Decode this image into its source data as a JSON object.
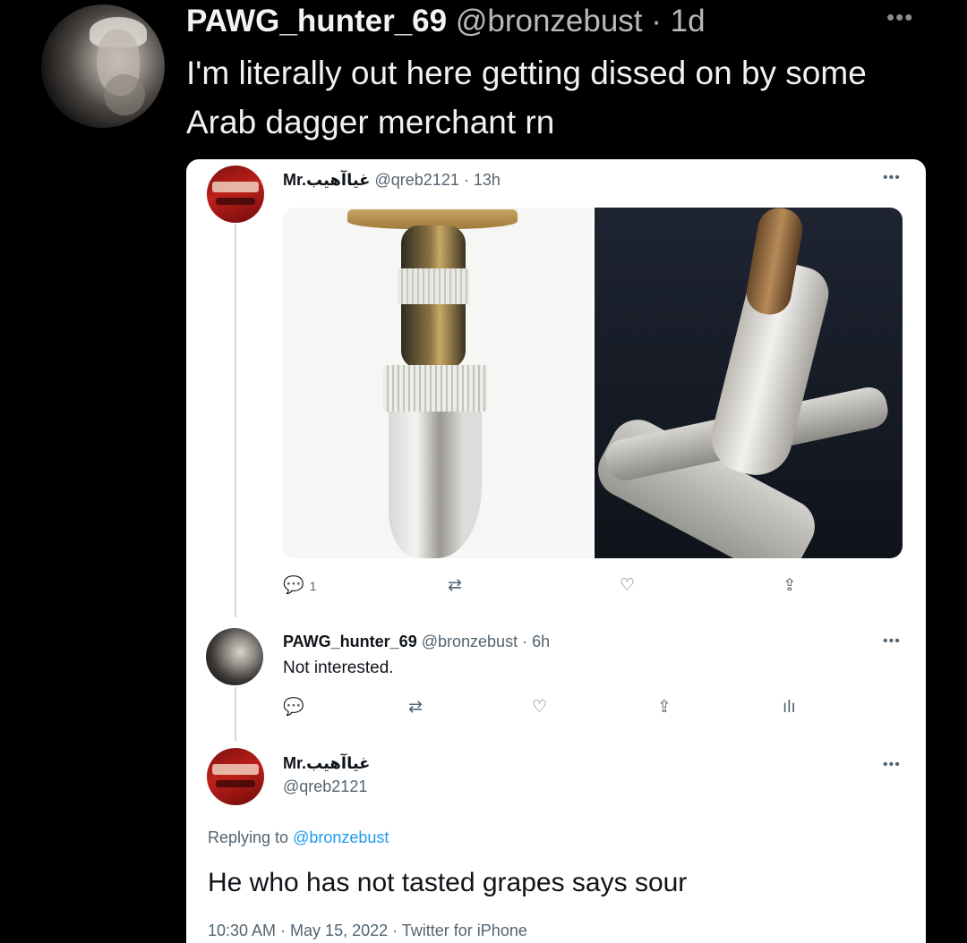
{
  "outer_tweet": {
    "display_name": "PAWG_hunter_69",
    "meta": "@bronzebust · 1d",
    "more_label": "•••",
    "text": "I'm literally out here getting dissed on by some Arab dagger merchant rn"
  },
  "quoted_tweet": {
    "display_name": "Mr.غياآهيب",
    "meta": "@qreb2121 · 13h",
    "more_label": "•••",
    "reply_count": "1"
  },
  "reply_tweet": {
    "display_name": "PAWG_hunter_69",
    "meta": "@bronzebust · 6h",
    "more_label": "•••",
    "text": "Not interested."
  },
  "final_tweet": {
    "display_name": "Mr.غياآهيب",
    "handle": "@qreb2121",
    "more_label": "•••",
    "replying_to_label": "Replying to",
    "replying_to_handle": "@bronzebust",
    "text": "He who has not tasted grapes says sour",
    "timestamp": "10:30 AM · May 15, 2022 · Twitter for iPhone"
  },
  "icons": {
    "reply": "💬",
    "retweet": "⇄",
    "like": "♡",
    "share": "⇪",
    "analytics": "ılı"
  }
}
